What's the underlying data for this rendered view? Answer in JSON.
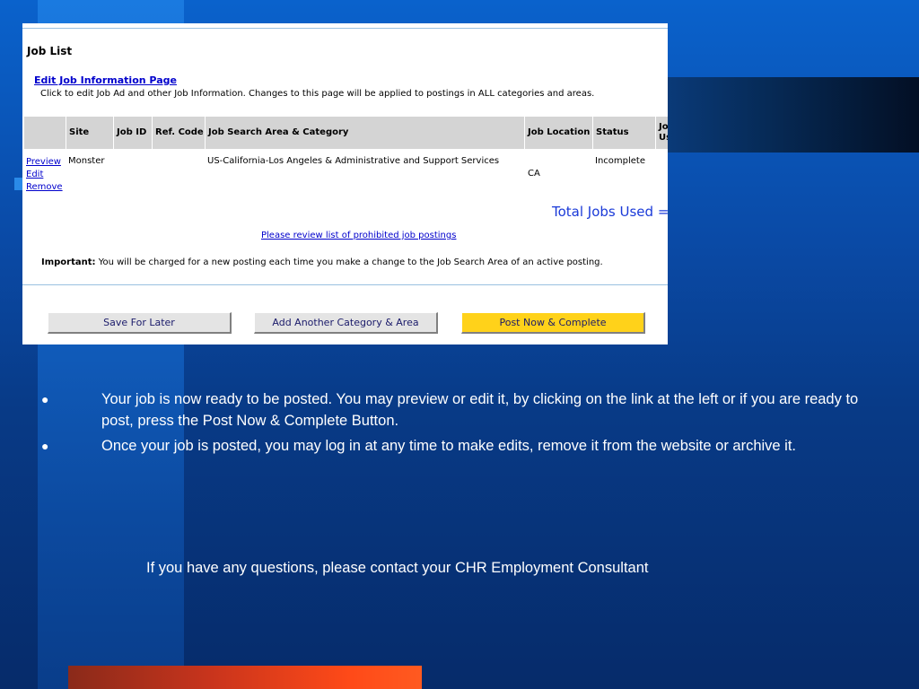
{
  "screenshot": {
    "title": "Job List",
    "edit_link": "Edit Job Information Page",
    "edit_desc": "Click to edit Job Ad and other Job Information. Changes to this page will be applied to postings in ALL categories and areas.",
    "columns": {
      "site": "Site",
      "job_id": "Job ID",
      "ref_code": "Ref. Code",
      "area_category": "Job Search Area & Category",
      "location": "Job Location",
      "status": "Status",
      "jobs_used_top": "Jo",
      "jobs_used_bottom": "Us"
    },
    "row": {
      "actions": [
        "Preview",
        "Edit",
        "Remove"
      ],
      "site": "Monster",
      "job_id": "",
      "ref_code": "",
      "area_category": "US-California-Los Angeles &  Administrative and Support Services",
      "location": "CA",
      "status": "Incomplete"
    },
    "total_jobs": "Total Jobs Used =",
    "prohibited_link": "Please review list of prohibited job postings",
    "important_label": "Important:",
    "important_text": " You will be charged for a new posting each time you make a change to the Job Search Area of an active posting.",
    "buttons": {
      "save": "Save For Later",
      "add": "Add Another Category & Area",
      "post": "Post Now & Complete"
    }
  },
  "bullets": [
    "Your job is now ready to be posted.  You may preview or edit it, by clicking on the link at the left or if you are ready to post, press the Post Now & Complete Button.",
    "Once your job is posted, you may log in at any time to make edits, remove it from the website or archive it."
  ],
  "bullet_glyph": "●",
  "contact": "If you have any questions, please contact your CHR Employment Consultant"
}
